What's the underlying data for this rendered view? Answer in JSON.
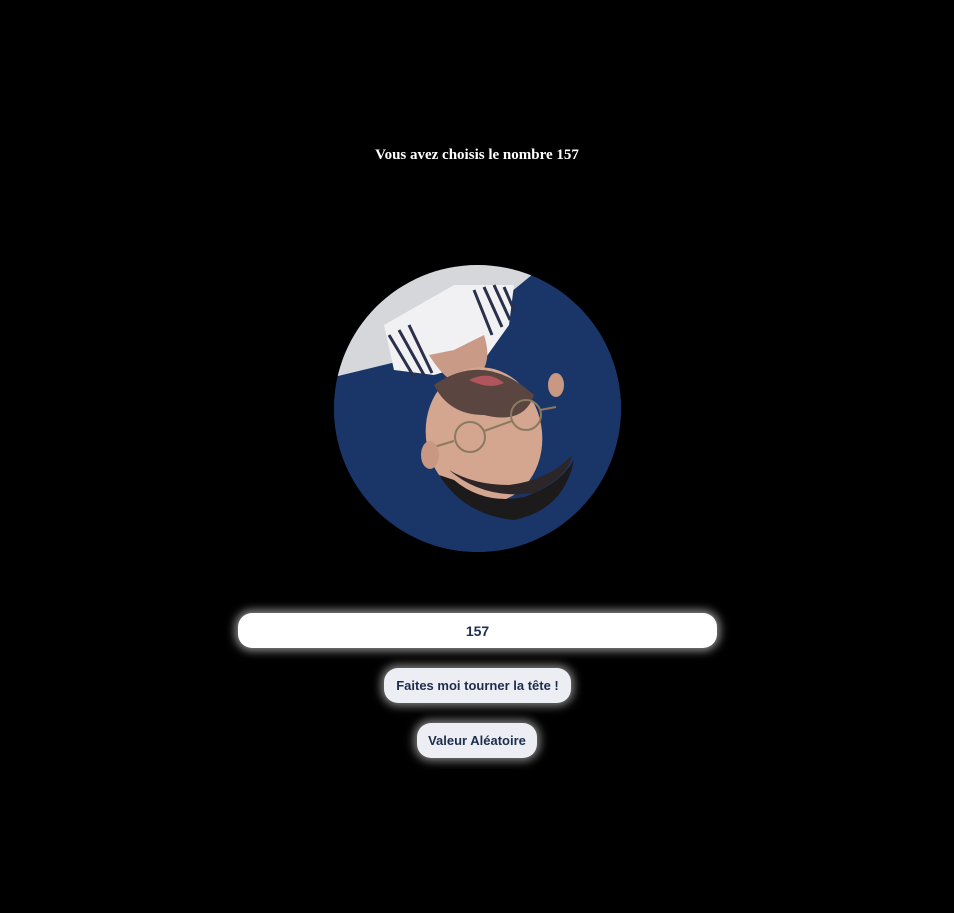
{
  "heading": {
    "prefix": "Vous avez choisis le nombre ",
    "number": "157"
  },
  "avatar": {
    "icon": "portrait-photo",
    "rotation_degrees": 157,
    "colors": {
      "background": "#1a3668",
      "wall": "#d8d8dc"
    }
  },
  "input": {
    "value": "157"
  },
  "buttons": {
    "rotate_label": "Faites moi tourner la tête !",
    "random_label": "Valeur Aléatoire"
  }
}
